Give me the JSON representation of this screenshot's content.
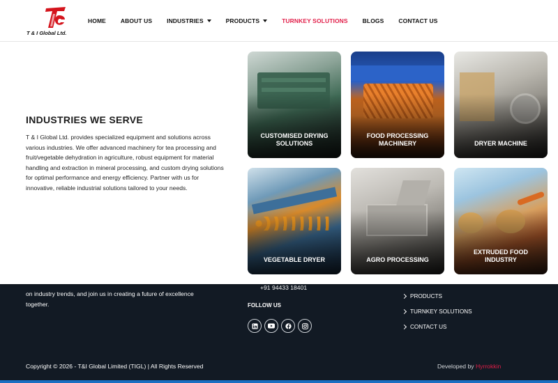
{
  "brand": {
    "name": "T & I Global Ltd.",
    "accent": "#e11d48"
  },
  "nav": {
    "items": [
      {
        "label": "HOME"
      },
      {
        "label": "ABOUT US"
      },
      {
        "label": "INDUSTRIES",
        "dropdown": true
      },
      {
        "label": "PRODUCTS",
        "dropdown": true
      },
      {
        "label": "TURNKEY SOLUTIONS",
        "active": true
      },
      {
        "label": "BLOGS"
      },
      {
        "label": "CONTACT US"
      }
    ]
  },
  "industries": {
    "title": "INDUSTRIES WE SERVE",
    "description": "T & I Global Ltd. provides specialized equipment and solutions across various industries. We offer advanced machinery for tea processing and fruit/vegetable dehydration in agriculture, robust equipment for material handling and extraction in mineral processing, and custom drying solutions for optimal performance and energy efficiency. Partner with us for innovative, reliable industrial solutions tailored to your needs.",
    "cards": [
      {
        "label": "CUSTOMISED DRYING SOLUTIONS"
      },
      {
        "label": "FOOD PROCESSING MACHINERY"
      },
      {
        "label": "DRYER MACHINE"
      },
      {
        "label": "VEGETABLE DRYER"
      },
      {
        "label": "AGRO PROCESSING"
      },
      {
        "label": "EXTRUDED FOOD INDUSTRY"
      }
    ]
  },
  "footer": {
    "text": "on industry trends, and join us in creating a future of excellence together.",
    "phone": "+91 94433 18401",
    "follow_label": "FOLLOW US",
    "socials": [
      "linkedin-icon",
      "youtube-icon",
      "facebook-icon",
      "instagram-icon"
    ],
    "links": [
      "PRODUCTS",
      "TURNKEY SOLUTIONS",
      "CONTACT US"
    ],
    "copyright": "Copyright © 2026 - T&I Global Limited (TIGL) | All Rights Reserved",
    "developed_by": "Developed by",
    "developer": "Hyrrokkin"
  }
}
